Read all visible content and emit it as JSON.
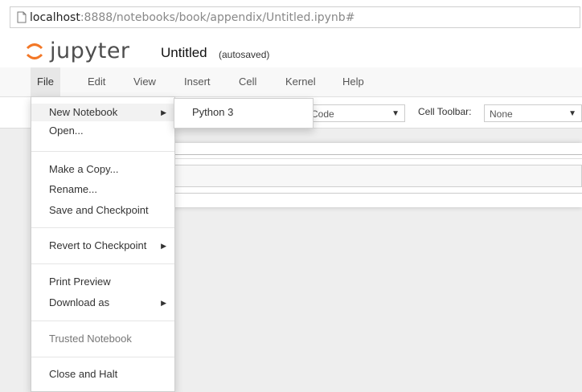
{
  "address_bar": {
    "host": "localhost",
    "rest": ":8888/notebooks/book/appendix/Untitled.ipynb#"
  },
  "header": {
    "logo_text": "jupyter",
    "notebook_name": "Untitled",
    "autosave_status": "(autosaved)"
  },
  "menubar": {
    "items": [
      "File",
      "Edit",
      "View",
      "Insert",
      "Cell",
      "Kernel",
      "Help"
    ],
    "active": "File"
  },
  "toolbar": {
    "cell_type_value": "Code",
    "cell_toolbar_label": "Cell Toolbar:",
    "cell_toolbar_value": "None"
  },
  "file_menu": {
    "items": [
      {
        "label": "New Notebook",
        "submenu": true
      },
      {
        "label": "Open..."
      },
      {
        "label": "Make a Copy..."
      },
      {
        "label": "Rename..."
      },
      {
        "label": "Save and Checkpoint"
      },
      {
        "label": "Revert to Checkpoint",
        "submenu": true
      },
      {
        "label": "Print Preview"
      },
      {
        "label": "Download as",
        "submenu": true
      },
      {
        "label": "Trusted Notebook",
        "disabled": true
      },
      {
        "label": "Close and Halt"
      }
    ]
  },
  "new_notebook_submenu": {
    "items": [
      "Python 3"
    ]
  },
  "colors": {
    "logo_orange": "#f37726",
    "menu_active": "#e7e7e7"
  }
}
